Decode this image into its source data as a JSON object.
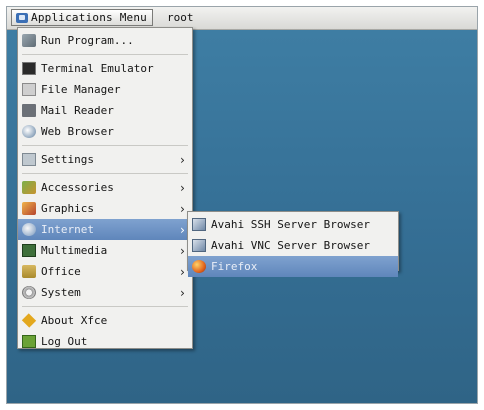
{
  "panel": {
    "applications_menu_label": "Applications Menu",
    "user_label": "root"
  },
  "main_menu": {
    "run_program": "Run Program...",
    "terminal": "Terminal Emulator",
    "file_manager": "File Manager",
    "mail_reader": "Mail Reader",
    "web_browser": "Web Browser",
    "settings": "Settings",
    "accessories": "Accessories",
    "graphics": "Graphics",
    "internet": "Internet",
    "multimedia": "Multimedia",
    "office": "Office",
    "system": "System",
    "about": "About Xfce",
    "log_out": "Log Out",
    "arrow": "›"
  },
  "internet_submenu": {
    "avahi_ssh": "Avahi SSH Server Browser",
    "avahi_vnc": "Avahi VNC Server Browser",
    "firefox": "Firefox"
  },
  "colors": {
    "desktop": "#3f7fa5",
    "menu_bg": "#f1f1ef",
    "highlight": "#6f94c6"
  },
  "icons": [
    "run-icon",
    "terminal-icon",
    "file-manager-icon",
    "mail-icon",
    "web-browser-icon",
    "settings-icon",
    "accessories-icon",
    "graphics-icon",
    "internet-icon",
    "multimedia-icon",
    "office-icon",
    "system-icon",
    "about-icon",
    "log-out-icon",
    "avahi-icon",
    "firefox-icon"
  ]
}
